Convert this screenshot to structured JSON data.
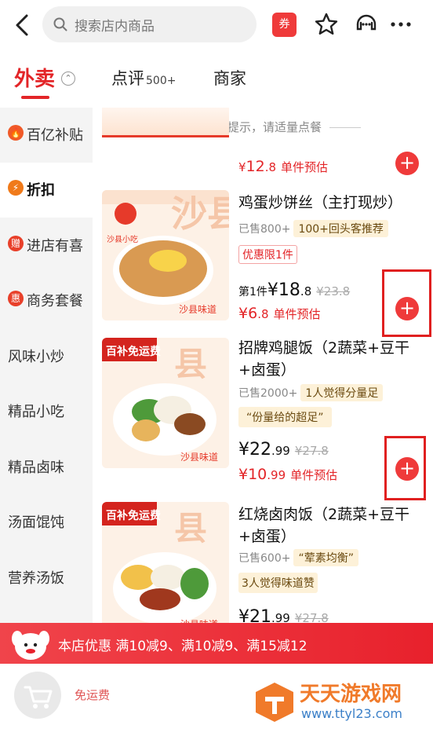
{
  "header": {
    "search_placeholder": "搜索店内商品",
    "coupon_label": "券"
  },
  "tabs": [
    {
      "label": "外卖",
      "active": true
    },
    {
      "label": "点评",
      "badge": "500+"
    },
    {
      "label": "商家"
    }
  ],
  "tab_collapse_symbol": "⌃",
  "sidebar": {
    "items": [
      {
        "label": "百亿补贴",
        "icon": "fire-icon",
        "icon_glyph": "🔥",
        "icon_color": "#f05a28"
      },
      {
        "label": "折扣",
        "icon": "lightning-icon",
        "icon_glyph": "⚡",
        "icon_color": "#f07a1a",
        "active": true
      },
      {
        "label": "进店有喜",
        "icon": "gift-icon",
        "icon_glyph": "赠",
        "icon_color": "#e8402a"
      },
      {
        "label": "商务套餐",
        "icon": "discount-icon",
        "icon_glyph": "惠",
        "icon_color": "#e8402a"
      },
      {
        "label": "风味小炒"
      },
      {
        "label": "精品小吃"
      },
      {
        "label": "精品卤味"
      },
      {
        "label": "汤面馄饨"
      },
      {
        "label": "营养汤饭"
      }
    ]
  },
  "tip": "温馨提示，请适量点餐",
  "prev_item": {
    "price_prefix": "¥",
    "price_int": "12",
    "price_dec": ".8",
    "estimate_label": "单件预估"
  },
  "items": [
    {
      "name": "鸡蛋炒饼丝（主打现炒）",
      "sold": "已售800+",
      "tag": "100+回头客推荐",
      "promo": "优惠限1件",
      "first_label": "第1件",
      "price_int": "¥18",
      "price_dec": ".8",
      "original": "¥23.8",
      "est_int": "¥6",
      "est_dec": ".8",
      "estimate_label": "单件预估"
    },
    {
      "name": "招牌鸡腿饭（2蔬菜+豆干+卤蛋）",
      "sold": "已售2000+",
      "tag": "1人觉得分量足",
      "praise": "“份量给的超足”",
      "badge": "百补免运费",
      "price_int": "¥22",
      "price_dec": ".99",
      "original": "¥27.8",
      "est_int": "¥10",
      "est_dec": ".99",
      "estimate_label": "单件预估"
    },
    {
      "name": "红烧卤肉饭（2蔬菜+豆干+卤蛋）",
      "sold": "已售600+",
      "tag": "“荤素均衡”",
      "praise": "3人觉得味道赞",
      "badge": "百补免运费",
      "price_int": "¥21",
      "price_dec": ".99",
      "original": "¥27.8"
    }
  ],
  "image_text": {
    "brand": "沙县小吃",
    "flavor": "沙县味道"
  },
  "promo_bar": {
    "text": "本店优惠 满10减9、满10减9、满15减12"
  },
  "cart": {
    "shipping": "免运费"
  },
  "watermark": {
    "title": "天天游戏网",
    "url": "www.ttyl23.com"
  },
  "colors": {
    "accent": "#e32528",
    "add_button": "#ef3a3a"
  }
}
